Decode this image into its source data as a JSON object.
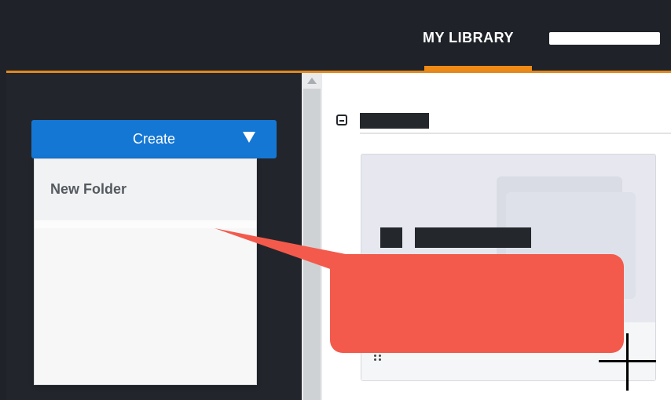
{
  "header": {
    "active_tab": "MY LIBRARY"
  },
  "sidebar": {
    "create_button": {
      "label": "Create"
    },
    "create_menu": {
      "items": [
        {
          "label": "New Folder"
        }
      ]
    }
  },
  "colors": {
    "header_bg": "#1f2329",
    "accent_orange": "#ef8a17",
    "create_blue": "#1577d4",
    "callout_red": "#f35a4b"
  }
}
